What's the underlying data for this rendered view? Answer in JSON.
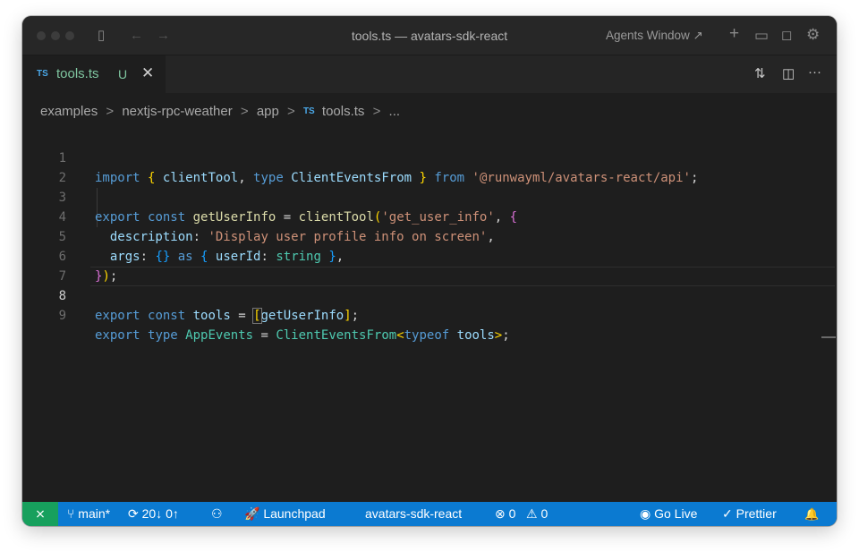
{
  "window": {
    "title": "tools.ts — avatars-sdk-react",
    "agents_window_label": "Agents Window ↗"
  },
  "titlebar_icons": {
    "sidebar_toggle": "▯",
    "back": "←",
    "forward": "→",
    "new": "+",
    "panel": "▭",
    "chat": "◻",
    "settings": "⚙"
  },
  "tab": {
    "lang_badge": "TS",
    "filename": "tools.ts",
    "status": "U",
    "close": "✕"
  },
  "tab_actions": {
    "compare": "⇅",
    "split": "◫",
    "more": "···"
  },
  "breadcrumb": {
    "items": [
      "examples",
      "nextjs-rpc-weather",
      "app"
    ],
    "file_badge": "TS",
    "file": "tools.ts",
    "more": "...",
    "separator": ">"
  },
  "editor": {
    "line_numbers": [
      "1",
      "2",
      "3",
      "4",
      "5",
      "6",
      "7",
      "8",
      "9"
    ],
    "active_line": 8,
    "lines": [
      "import { clientTool, type ClientEventsFrom } from '@runwayml/avatars-react/api';",
      "",
      "export const getUserInfo = clientTool('get_user_info', {",
      "  description: 'Display user profile info on screen',",
      "  args: {} as { userId: string },",
      "});",
      "",
      "export const tools = [getUserInfo];",
      "export type AppEvents = ClientEventsFrom<typeof tools>;"
    ]
  },
  "statusbar": {
    "remote_icon": "⨯",
    "branch": "⑂ main*",
    "sync": "⟳ 20↓ 0↑",
    "source_control_icon": "⚇",
    "launchpad": "🚀 Launchpad",
    "project": "avatars-sdk-react",
    "errors": "⊗ 0",
    "warnings": "⚠ 0",
    "go_live": "◉ Go Live",
    "prettier": "✓ Prettier",
    "bell": "🔔"
  },
  "colors": {
    "statusbar_bg": "#0b7ad1",
    "remote_bg": "#17a05d",
    "editor_bg": "#1e1e1e",
    "keyword": "#569cd6",
    "string": "#ce9178",
    "untracked": "#7fc6a0"
  }
}
